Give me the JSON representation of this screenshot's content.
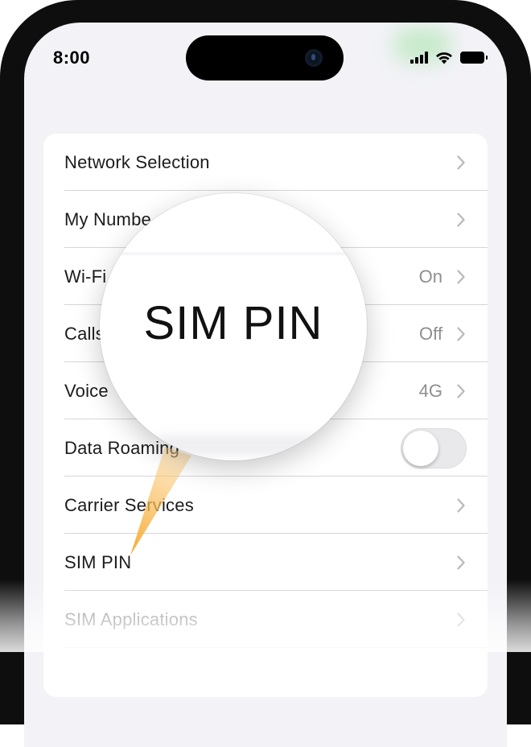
{
  "status_bar": {
    "time": "8:00",
    "icons": [
      "signal-icon",
      "wifi-icon",
      "battery-icon"
    ]
  },
  "section_header": "",
  "settings": {
    "rows": [
      {
        "label": "Network Selection",
        "value": "",
        "accessory": "chevron"
      },
      {
        "label": "My Number",
        "value": "",
        "accessory": "chevron"
      },
      {
        "label": "Wi-Fi Calling",
        "value": "On",
        "accessory": "chevron"
      },
      {
        "label": "Calls on Other Devices",
        "value": "Off",
        "accessory": "chevron"
      },
      {
        "label": "Voice & Data",
        "value": "4G",
        "accessory": "chevron"
      },
      {
        "label": "Data Roaming",
        "value": "",
        "accessory": "toggle",
        "toggle_on": false
      },
      {
        "label": "Carrier Services",
        "value": "",
        "accessory": "chevron"
      },
      {
        "label": "SIM PIN",
        "value": "",
        "accessory": "chevron"
      },
      {
        "label": "SIM Applications",
        "value": "",
        "accessory": "chevron"
      }
    ],
    "visible_labels": [
      "Network Selection",
      "My Numbe",
      "Wi-Fi",
      "Calls",
      "Voice",
      "Data Roaming",
      "Carrier Services",
      "SIM PIN",
      "SIM Applications"
    ]
  },
  "magnifier": {
    "text": "SIM PIN"
  },
  "colors": {
    "screen_background": "#f2f2f7",
    "card_background": "#ffffff",
    "label_text": "#1c1c1e",
    "secondary_text": "#8e8e93",
    "callout_beam": "#f6b23a"
  }
}
